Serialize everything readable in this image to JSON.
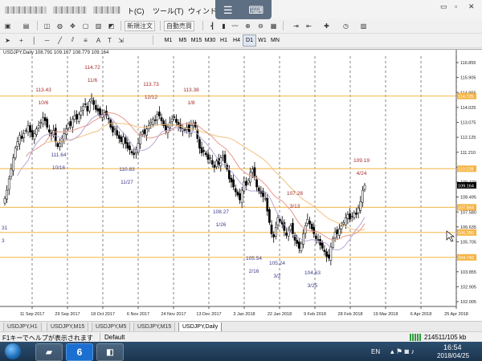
{
  "menubar": {
    "items": [
      {
        "label": "ト(C)"
      },
      {
        "label": "ツール(T)"
      },
      {
        "label": "ウィンドウ"
      }
    ],
    "window_buttons": [
      "▭",
      "▫",
      "✕"
    ]
  },
  "toolbar": {
    "new_order_label": "新規注文",
    "auto_trade_label": "自動売買",
    "timeframes": [
      "M1",
      "M5",
      "M15",
      "M30",
      "H1",
      "H4",
      "D1",
      "W1",
      "MN"
    ],
    "active_timeframe": "D1"
  },
  "chart": {
    "title": "USDJPY,Daily  108.791 109.167 108.779 109.164",
    "current_price": "109.164",
    "colors": {
      "candle": "#000000",
      "hline": "#f5b545",
      "vline": "#333333",
      "annotation_high": "#a52a2a",
      "annotation_low": "#3c3c8c",
      "ma_orange": "#f2c17e",
      "ma_red": "#e89a8a",
      "ma_purple": "#b9a6d8",
      "ma_green": "#a3d6a3"
    }
  },
  "chart_data": {
    "type": "candlestick",
    "symbol": "USDJPY",
    "timeframe": "Daily",
    "y_axis_labels": [
      "116.855",
      "115.905",
      "114.955",
      "114.025",
      "113.075",
      "112.125",
      "111.210",
      "110.260",
      "109.420",
      "108.495",
      "107.580",
      "106.635",
      "105.705",
      "104.785",
      "103.855",
      "102.905",
      "102.005"
    ],
    "y_range": [
      101.7,
      117.2
    ],
    "x_axis_labels": [
      "11 Sep 2017",
      "29 Sep 2017",
      "18 Oct 2017",
      "6 Nov 2017",
      "24 Nov 2017",
      "13 Dec 2017",
      "3 Jan 2018",
      "22 Jan 2018",
      "9 Feb 2018",
      "28 Feb 2018",
      "19 Mar 2018",
      "6 Apr 2018",
      "25 Apr 2018"
    ],
    "horizontal_lines": [
      {
        "value": 114.73,
        "label": "114.725"
      },
      {
        "value": 110.23,
        "label": "110.228"
      },
      {
        "value": 107.84,
        "label": "107.844"
      },
      {
        "value": 106.28,
        "label": "106.280"
      },
      {
        "value": 104.74,
        "label": "104.740"
      }
    ],
    "annotations": [
      {
        "price": "113.43",
        "date": "10/6",
        "kind": "high"
      },
      {
        "price": "114.72",
        "date": "11/6",
        "kind": "high"
      },
      {
        "price": "113.73",
        "date": "12/12",
        "kind": "high"
      },
      {
        "price": "113.38",
        "date": "1/8",
        "kind": "high"
      },
      {
        "price": "107.28",
        "date": "3/13",
        "kind": "high"
      },
      {
        "price": "109.19",
        "date": "4/24",
        "kind": "high"
      },
      {
        "price": "111.64",
        "date": "10/16",
        "kind": "low"
      },
      {
        "price": "110.83",
        "date": "11/27",
        "kind": "low"
      },
      {
        "price": "108.27",
        "date": "1/26",
        "kind": "low"
      },
      {
        "price": "105.54",
        "date": "2/16",
        "kind": "low"
      },
      {
        "price": "105.24",
        "date": "3/2",
        "kind": "low"
      },
      {
        "price": "104.63",
        "date": "3/25",
        "kind": "low"
      }
    ],
    "edge_partial_labels": [
      "31",
      "3"
    ],
    "closes": [
      108.4,
      108.9,
      109.6,
      110.2,
      110.9,
      111.5,
      111.9,
      112.3,
      112.1,
      112.4,
      112.6,
      112.9,
      112.5,
      112.2,
      112.4,
      112.7,
      112.9,
      113.1,
      113.4,
      113.2,
      112.8,
      112.5,
      112.3,
      112.6,
      111.9,
      111.6,
      111.8,
      112.1,
      112.4,
      112.7,
      113.0,
      112.9,
      113.3,
      113.5,
      113.3,
      113.6,
      113.8,
      114.1,
      114.2,
      113.8,
      114.4,
      114.6,
      114.2,
      113.9,
      113.8,
      113.5,
      113.6,
      113.7,
      113.5,
      113.3,
      112.8,
      112.5,
      112.7,
      112.3,
      112.1,
      111.9,
      112.2,
      111.8,
      111.5,
      111.4,
      111.2,
      111.1,
      111.4,
      111.8,
      112.3,
      112.5,
      112.4,
      112.7,
      112.9,
      113.1,
      113.3,
      113.2,
      113.6,
      113.5,
      113.2,
      112.9,
      112.6,
      112.8,
      113.1,
      113.3,
      113.4,
      113.1,
      112.9,
      112.7,
      112.7,
      112.6,
      112.8,
      112.5,
      112.9,
      113.0,
      112.8,
      112.1,
      111.5,
      111.2,
      111.3,
      111.1,
      110.8,
      110.9,
      110.5,
      110.3,
      110.7,
      110.5,
      110.9,
      111.0,
      110.6,
      110.2,
      109.6,
      109.4,
      109.1,
      108.8,
      108.6,
      108.3,
      108.9,
      109.4,
      109.2,
      109.5,
      110.0,
      110.2,
      109.7,
      109.1,
      108.8,
      108.7,
      108.5,
      108.4,
      107.6,
      106.9,
      106.2,
      106.0,
      106.6,
      107.2,
      107.0,
      106.8,
      106.4,
      106.1,
      106.4,
      106.7,
      106.2,
      105.8,
      105.6,
      105.3,
      105.6,
      106.2,
      106.7,
      107.1,
      106.8,
      106.5,
      106.2,
      105.9,
      105.8,
      105.5,
      105.3,
      105.1,
      104.8,
      104.7,
      105.4,
      105.9,
      106.3,
      106.2,
      106.5,
      106.7,
      106.9,
      107.2,
      107.4,
      107.1,
      107.3,
      107.5,
      107.4,
      107.8,
      108.2,
      108.9,
      109.2
    ]
  },
  "tabs": [
    "USDJPY,H1",
    "USDJPY,M15",
    "USDJPY,M5",
    "USDJPY,M15",
    "USDJPY,Daily"
  ],
  "active_tab": "USDJPY,Daily",
  "statusbar": {
    "help_text": "F1キーでヘルプが表示されます",
    "profile": "Default",
    "traffic": "214511/105 kb"
  },
  "taskbar": {
    "lang": "EN",
    "time": "16:54",
    "date": "2018/04/25"
  }
}
